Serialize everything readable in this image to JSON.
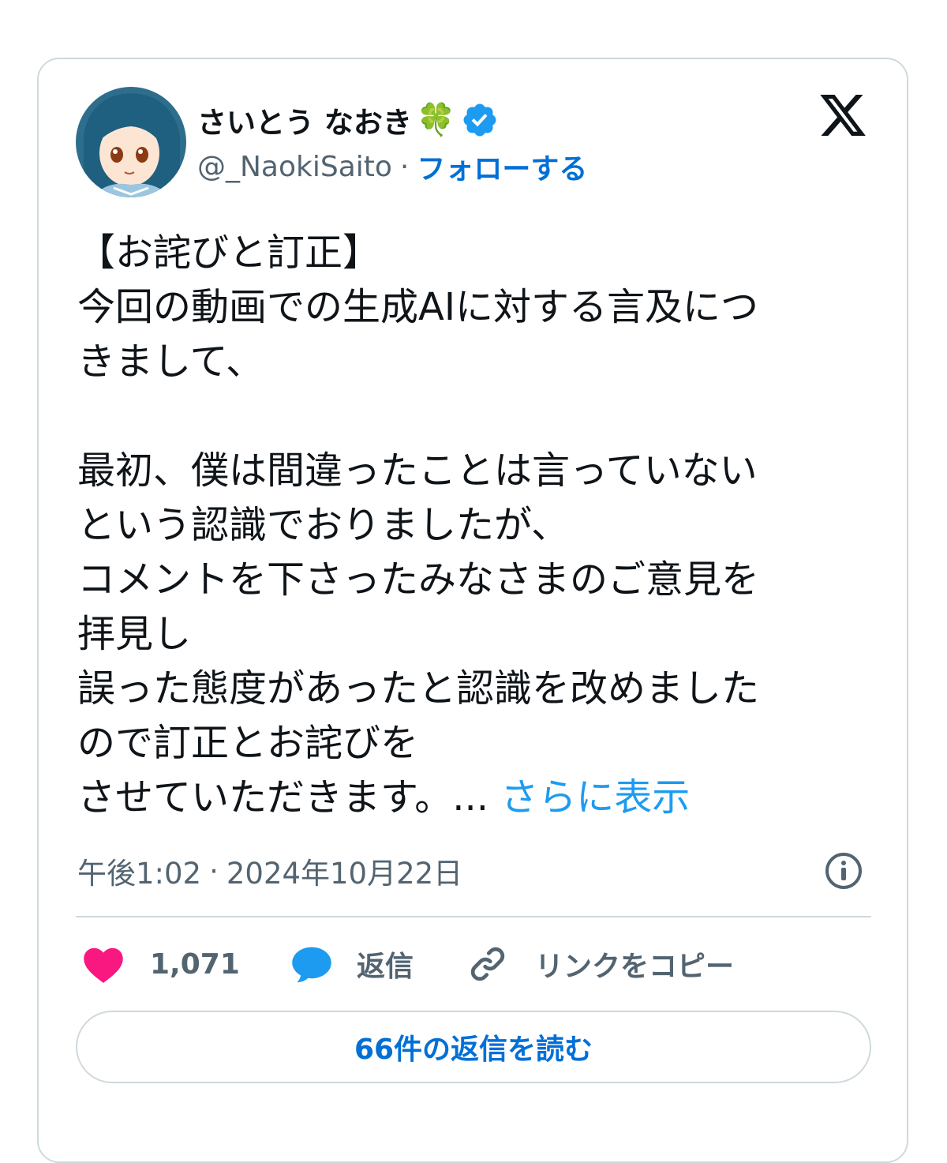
{
  "author": {
    "display_name": "さいとう なおき",
    "emoji": "🍀",
    "handle": "@_NaokiSaito",
    "separator": "·",
    "follow_label": "フォローする"
  },
  "tweet": {
    "lines": [
      "【お詫びと訂正】",
      "今回の動画での生成AIに対する言及につ",
      "きまして、",
      "",
      "最初、僕は間違ったことは言っていない",
      "という認識でおりましたが、",
      "コメントを下さったみなさまのご意見を",
      "拝見し",
      "誤った態度があったと認識を改めました",
      "ので訂正とお詫びを",
      "させていただきます。..."
    ],
    "show_more": "さらに表示"
  },
  "meta": {
    "time": "午後1:02",
    "separator": "·",
    "date": "2024年10月22日"
  },
  "actions": {
    "like_count": "1,071",
    "reply_label": "返信",
    "copy_link_label": "リンクをコピー"
  },
  "read_replies_label": "66件の返信を読む",
  "colors": {
    "accent": "#1d9bf0",
    "link_bold": "#006fd6",
    "like": "#f91880",
    "secondary_text": "#536471",
    "border": "#cfd9de"
  },
  "icons": [
    "clover-emoji",
    "verified-badge-icon",
    "x-logo-icon",
    "info-icon",
    "heart-icon",
    "reply-bubble-icon",
    "link-icon"
  ]
}
